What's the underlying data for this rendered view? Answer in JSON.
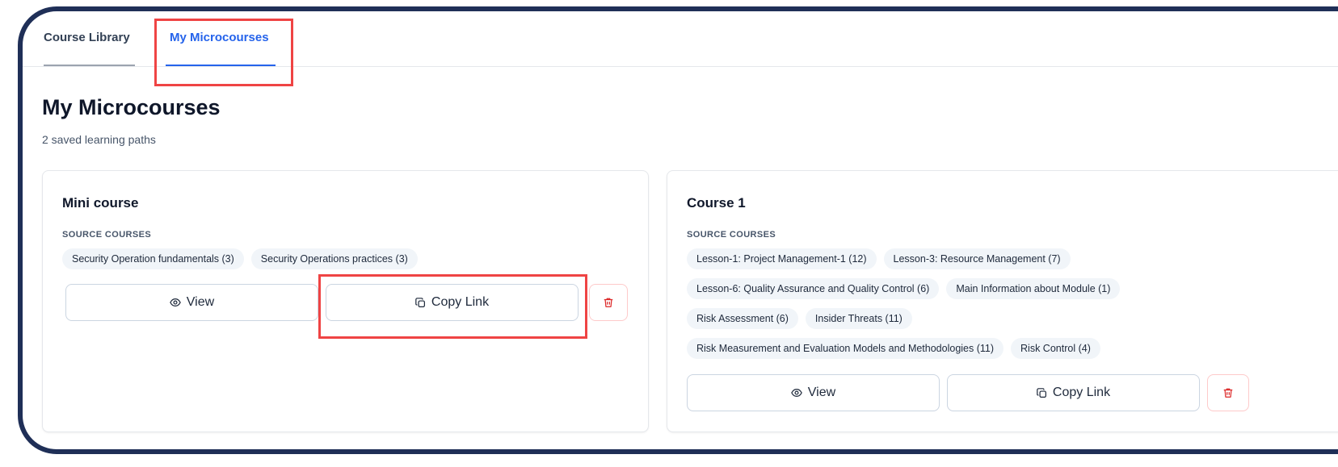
{
  "tabs": [
    {
      "label": "Course Library"
    },
    {
      "label": "My Microcourses"
    }
  ],
  "page": {
    "title": "My Microcourses",
    "subtitle": "2 saved learning paths"
  },
  "cards": [
    {
      "title": "Mini course",
      "section_label": "SOURCE COURSES",
      "chips": [
        "Security Operation fundamentals (3)",
        "Security Operations practices (3)"
      ],
      "view_label": "View",
      "copy_label": "Copy Link"
    },
    {
      "title": "Course 1",
      "section_label": "SOURCE COURSES",
      "chips": [
        "Lesson-1: Project Management-1 (12)",
        "Lesson-3: Resource Management (7)",
        "Lesson-6: Quality Assurance and Quality Control (6)",
        "Main Information about Module (1)",
        "Risk Assessment (6)",
        "Insider Threats (11)",
        "Risk Measurement and Evaluation Models and Methodologies (11)",
        "Risk Control (4)"
      ],
      "view_label": "View",
      "copy_label": "Copy Link"
    }
  ],
  "colors": {
    "accent": "#2563eb",
    "frame": "#1f2f57",
    "highlight": "#ef4444",
    "delete": "#dc2626",
    "chip_bg": "#f1f5f9"
  },
  "icons": {
    "view": "eye-icon",
    "copy": "copy-icon",
    "delete": "trash-icon"
  }
}
